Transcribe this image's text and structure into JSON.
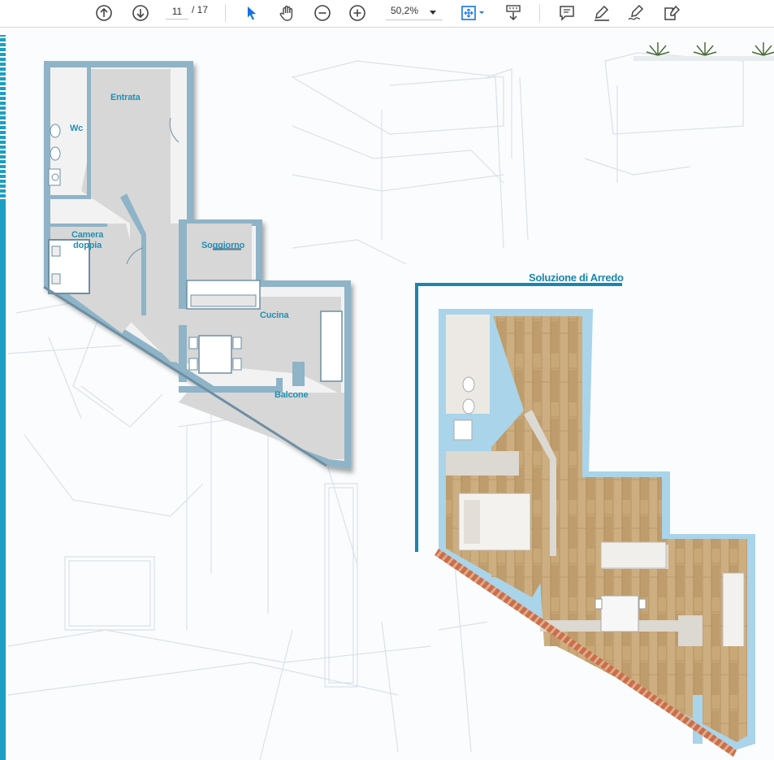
{
  "toolbar": {
    "current_page": "11",
    "total_pages": "/ 17",
    "zoom": "50,2%",
    "icons": [
      "page-up-icon",
      "page-down-icon",
      "select-arrow-icon",
      "hand-icon",
      "zoom-out-icon",
      "zoom-in-icon",
      "fit-page-icon",
      "scroll-mode-icon",
      "comment-icon",
      "highlight-icon",
      "sign-icon",
      "fill-sign-icon"
    ],
    "accent": "#1473e6"
  },
  "document": {
    "plan_labels": {
      "entrata": "Entrata",
      "wc": "Wc",
      "camera": "Camera\ndoppia",
      "soggiorno": "Soggiorno",
      "cucina": "Cucina",
      "balcone": "Balcone"
    },
    "furnished_title": "Soluzione di Arredo",
    "colors": {
      "brand_blue": "#1c9fc2",
      "wall": "#8fb3c7",
      "floor": "#d6d6d6",
      "wood": "#c9a877"
    }
  }
}
